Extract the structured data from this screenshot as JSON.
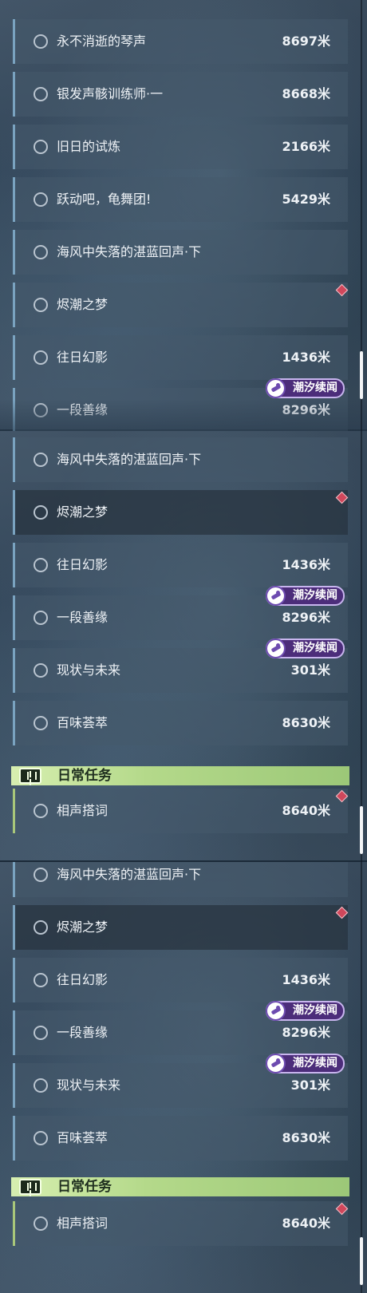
{
  "panel_1": {
    "quests": [
      {
        "title": "永不消逝的琴声",
        "distance": "8697米"
      },
      {
        "title": "银发声骸训练师·一",
        "distance": "8668米"
      },
      {
        "title": "旧日的试炼",
        "distance": "2166米"
      },
      {
        "title": "跃动吧，龟舞团!",
        "distance": "5429米"
      },
      {
        "title": "海风中失落的湛蓝回声·下",
        "distance": ""
      },
      {
        "title": "烬潮之梦",
        "distance": ""
      },
      {
        "title": "往日幻影",
        "distance": "1436米"
      },
      {
        "title": "一段善缘",
        "distance": "8296米",
        "tag": "潮汐续闻"
      }
    ]
  },
  "panel_2": {
    "quests": [
      {
        "title": "海风中失落的湛蓝回声·下",
        "distance": ""
      },
      {
        "title": "烬潮之梦",
        "distance": ""
      },
      {
        "title": "往日幻影",
        "distance": "1436米"
      },
      {
        "title": "一段善缘",
        "distance": "8296米",
        "tag": "潮汐续闻"
      },
      {
        "title": "现状与未来",
        "distance": "301米",
        "tag": "潮汐续闻"
      },
      {
        "title": "百味荟萃",
        "distance": "8630米"
      }
    ],
    "section_header": "日常任务",
    "daily_quests": [
      {
        "title": "相声搭词",
        "distance": "8640米"
      }
    ]
  },
  "panel_3": {
    "quests": [
      {
        "title": "海风中失落的湛蓝回声·下",
        "distance": ""
      },
      {
        "title": "烬潮之梦",
        "distance": ""
      },
      {
        "title": "往日幻影",
        "distance": "1436米"
      },
      {
        "title": "一段善缘",
        "distance": "8296米",
        "tag": "潮汐续闻"
      },
      {
        "title": "现状与未来",
        "distance": "301米",
        "tag": "潮汐续闻"
      },
      {
        "title": "百味荟萃",
        "distance": "8630米"
      }
    ],
    "section_header": "日常任务",
    "daily_quests": [
      {
        "title": "相声搭词",
        "distance": "8640米"
      }
    ]
  },
  "colors": {
    "tracked_marker": "#d0475b",
    "story_tag_bg": "#4c2d7a",
    "daily_header": "#b4d98a",
    "row_accent": "#7aa3c0"
  },
  "icons": {
    "quest_status": "circle-outline-icon",
    "tracked_marker": "red-diamond-icon",
    "story_tag": "tidal-story-icon",
    "daily_header": "exclamation-icon"
  }
}
